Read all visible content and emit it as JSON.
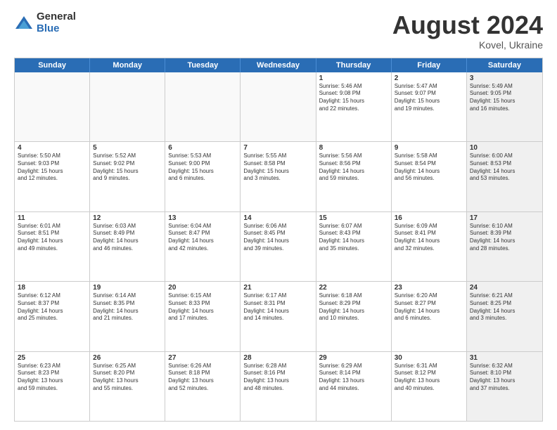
{
  "logo": {
    "general": "General",
    "blue": "Blue"
  },
  "title": "August 2024",
  "subtitle": "Kovel, Ukraine",
  "header_days": [
    "Sunday",
    "Monday",
    "Tuesday",
    "Wednesday",
    "Thursday",
    "Friday",
    "Saturday"
  ],
  "rows": [
    [
      {
        "day": "",
        "info": "",
        "empty": true
      },
      {
        "day": "",
        "info": "",
        "empty": true
      },
      {
        "day": "",
        "info": "",
        "empty": true
      },
      {
        "day": "",
        "info": "",
        "empty": true
      },
      {
        "day": "1",
        "info": "Sunrise: 5:46 AM\nSunset: 9:08 PM\nDaylight: 15 hours\nand 22 minutes."
      },
      {
        "day": "2",
        "info": "Sunrise: 5:47 AM\nSunset: 9:07 PM\nDaylight: 15 hours\nand 19 minutes."
      },
      {
        "day": "3",
        "info": "Sunrise: 5:49 AM\nSunset: 9:05 PM\nDaylight: 15 hours\nand 16 minutes.",
        "shaded": true
      }
    ],
    [
      {
        "day": "4",
        "info": "Sunrise: 5:50 AM\nSunset: 9:03 PM\nDaylight: 15 hours\nand 12 minutes."
      },
      {
        "day": "5",
        "info": "Sunrise: 5:52 AM\nSunset: 9:02 PM\nDaylight: 15 hours\nand 9 minutes."
      },
      {
        "day": "6",
        "info": "Sunrise: 5:53 AM\nSunset: 9:00 PM\nDaylight: 15 hours\nand 6 minutes."
      },
      {
        "day": "7",
        "info": "Sunrise: 5:55 AM\nSunset: 8:58 PM\nDaylight: 15 hours\nand 3 minutes."
      },
      {
        "day": "8",
        "info": "Sunrise: 5:56 AM\nSunset: 8:56 PM\nDaylight: 14 hours\nand 59 minutes."
      },
      {
        "day": "9",
        "info": "Sunrise: 5:58 AM\nSunset: 8:54 PM\nDaylight: 14 hours\nand 56 minutes."
      },
      {
        "day": "10",
        "info": "Sunrise: 6:00 AM\nSunset: 8:53 PM\nDaylight: 14 hours\nand 53 minutes.",
        "shaded": true
      }
    ],
    [
      {
        "day": "11",
        "info": "Sunrise: 6:01 AM\nSunset: 8:51 PM\nDaylight: 14 hours\nand 49 minutes."
      },
      {
        "day": "12",
        "info": "Sunrise: 6:03 AM\nSunset: 8:49 PM\nDaylight: 14 hours\nand 46 minutes."
      },
      {
        "day": "13",
        "info": "Sunrise: 6:04 AM\nSunset: 8:47 PM\nDaylight: 14 hours\nand 42 minutes."
      },
      {
        "day": "14",
        "info": "Sunrise: 6:06 AM\nSunset: 8:45 PM\nDaylight: 14 hours\nand 39 minutes."
      },
      {
        "day": "15",
        "info": "Sunrise: 6:07 AM\nSunset: 8:43 PM\nDaylight: 14 hours\nand 35 minutes."
      },
      {
        "day": "16",
        "info": "Sunrise: 6:09 AM\nSunset: 8:41 PM\nDaylight: 14 hours\nand 32 minutes."
      },
      {
        "day": "17",
        "info": "Sunrise: 6:10 AM\nSunset: 8:39 PM\nDaylight: 14 hours\nand 28 minutes.",
        "shaded": true
      }
    ],
    [
      {
        "day": "18",
        "info": "Sunrise: 6:12 AM\nSunset: 8:37 PM\nDaylight: 14 hours\nand 25 minutes."
      },
      {
        "day": "19",
        "info": "Sunrise: 6:14 AM\nSunset: 8:35 PM\nDaylight: 14 hours\nand 21 minutes."
      },
      {
        "day": "20",
        "info": "Sunrise: 6:15 AM\nSunset: 8:33 PM\nDaylight: 14 hours\nand 17 minutes."
      },
      {
        "day": "21",
        "info": "Sunrise: 6:17 AM\nSunset: 8:31 PM\nDaylight: 14 hours\nand 14 minutes."
      },
      {
        "day": "22",
        "info": "Sunrise: 6:18 AM\nSunset: 8:29 PM\nDaylight: 14 hours\nand 10 minutes."
      },
      {
        "day": "23",
        "info": "Sunrise: 6:20 AM\nSunset: 8:27 PM\nDaylight: 14 hours\nand 6 minutes."
      },
      {
        "day": "24",
        "info": "Sunrise: 6:21 AM\nSunset: 8:25 PM\nDaylight: 14 hours\nand 3 minutes.",
        "shaded": true
      }
    ],
    [
      {
        "day": "25",
        "info": "Sunrise: 6:23 AM\nSunset: 8:23 PM\nDaylight: 13 hours\nand 59 minutes."
      },
      {
        "day": "26",
        "info": "Sunrise: 6:25 AM\nSunset: 8:20 PM\nDaylight: 13 hours\nand 55 minutes."
      },
      {
        "day": "27",
        "info": "Sunrise: 6:26 AM\nSunset: 8:18 PM\nDaylight: 13 hours\nand 52 minutes."
      },
      {
        "day": "28",
        "info": "Sunrise: 6:28 AM\nSunset: 8:16 PM\nDaylight: 13 hours\nand 48 minutes."
      },
      {
        "day": "29",
        "info": "Sunrise: 6:29 AM\nSunset: 8:14 PM\nDaylight: 13 hours\nand 44 minutes."
      },
      {
        "day": "30",
        "info": "Sunrise: 6:31 AM\nSunset: 8:12 PM\nDaylight: 13 hours\nand 40 minutes."
      },
      {
        "day": "31",
        "info": "Sunrise: 6:32 AM\nSunset: 8:10 PM\nDaylight: 13 hours\nand 37 minutes.",
        "shaded": true
      }
    ]
  ]
}
